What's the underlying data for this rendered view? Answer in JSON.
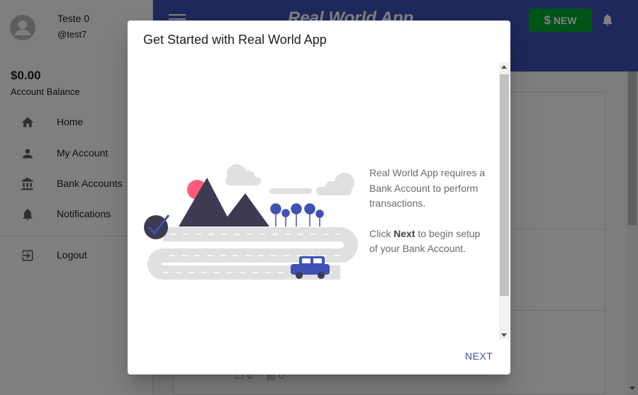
{
  "user": {
    "name": "Teste 0",
    "handle": "@test7"
  },
  "balance": {
    "amount": "$0.00",
    "label": "Account Balance"
  },
  "nav": {
    "items": [
      {
        "label": "Home",
        "icon": "home-icon"
      },
      {
        "label": "My Account",
        "icon": "person-icon"
      },
      {
        "label": "Bank Accounts",
        "icon": "bank-icon"
      },
      {
        "label": "Notifications",
        "icon": "bell-icon"
      }
    ],
    "logout": {
      "label": "Logout",
      "icon": "logout-icon"
    }
  },
  "appbar": {
    "logo": "Real World App",
    "new_label": "NEW",
    "new_symbol": "$"
  },
  "dialog": {
    "title": "Get Started with Real World App",
    "line1": "Real World App requires a Bank Account to perform transactions.",
    "line2_prefix": "Click ",
    "line2_bold": "Next",
    "line2_suffix": " to begin setup of your Bank Account.",
    "next_label": "NEXT"
  },
  "feed": {
    "likes": "0",
    "comments": "0"
  },
  "colors": {
    "primary": "#3f51b5",
    "new_button": "#00a82d",
    "accent_pink": "#ff5a7a",
    "mountain": "#3d3b52"
  }
}
